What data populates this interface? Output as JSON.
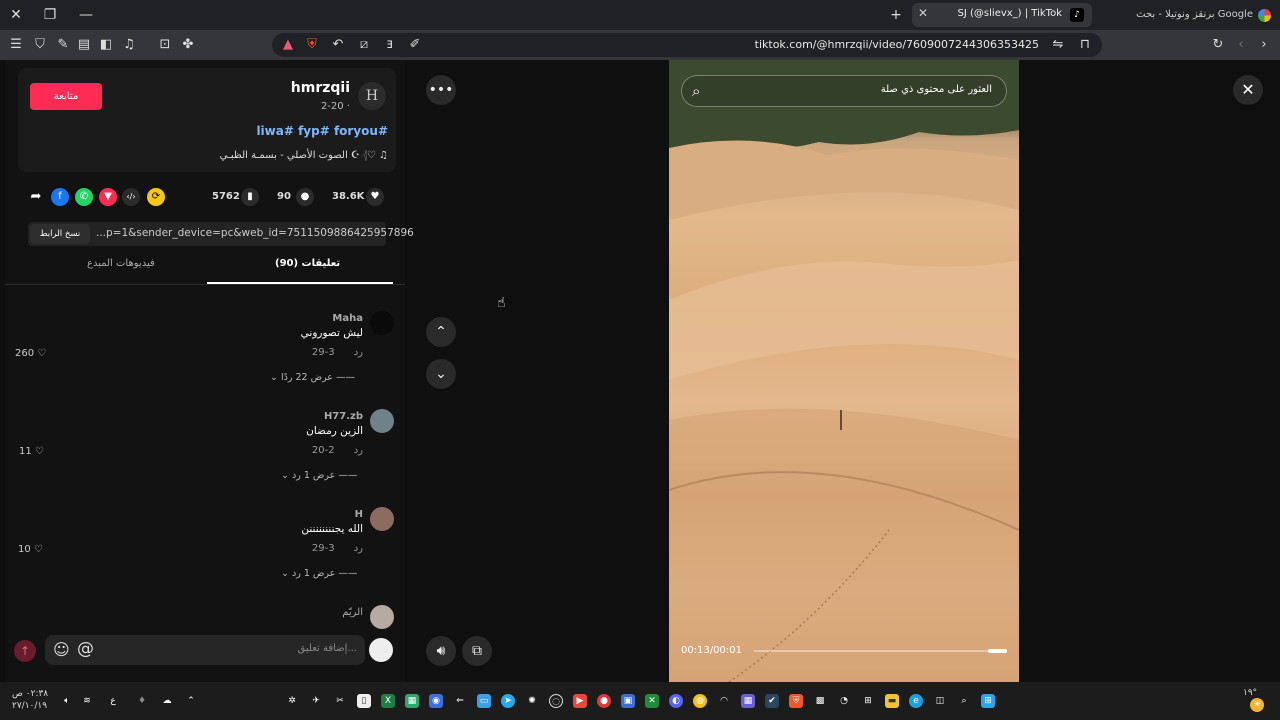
{
  "browser": {
    "active_tab_title": "SJ (@slievx_) | TikTok",
    "google_tab_title": "برنقز ونوتيلا - بحث Google",
    "url": "tiktok.com/@hmrzqii/video/7609007244306353425"
  },
  "author": {
    "avatar_letter": "H",
    "name": "hmrzqii",
    "date": "2-20 ·",
    "follow_label": "متابعة",
    "caption": "liwa# fyp# foryou#",
    "sound": "الصوت الأصلي - بسمـة الظبـي ☪︎ 𓂆♡"
  },
  "actions": {
    "likes": "38.6K",
    "comments": "90",
    "saves": "5762",
    "link": "...p=1&sender_device=pc&web_id=7511509886425957896",
    "copy_link_label": "نسخ الرابط"
  },
  "tabs": {
    "comments_label": "(90) تعليقات",
    "creator_videos_label": "فيديوهات المبدع"
  },
  "comments": [
    {
      "name": "Maha",
      "text": "ليش تصوروني",
      "date": "3-29",
      "reply": "رد",
      "likes": "260",
      "replies": "عرض 22 ردًا"
    },
    {
      "name": "H77.zb",
      "text": "الزين رمضان",
      "date": "2-20",
      "reply": "رد",
      "likes": "11",
      "replies": "عرض 1 رد"
    },
    {
      "name": "H",
      "text": "الله يجننننننننن",
      "date": "3-29",
      "reply": "رد",
      "likes": "10",
      "replies": "عرض 1 رد"
    },
    {
      "name": "الريّم"
    }
  ],
  "comment_input": {
    "placeholder": "إضافة تعليق..."
  },
  "video": {
    "search_placeholder": "العثور على محتوى ذي صلة",
    "time": "00:13/00:01",
    "progress": 0.92
  },
  "taskbar": {
    "time": "٠٢:٣٨ ص",
    "date": "٢٧/١٠/١٩",
    "lang": "ع",
    "temp": "١٩°"
  },
  "colors": {
    "accent": "#fe2c55",
    "link": "#7fb7ff"
  }
}
